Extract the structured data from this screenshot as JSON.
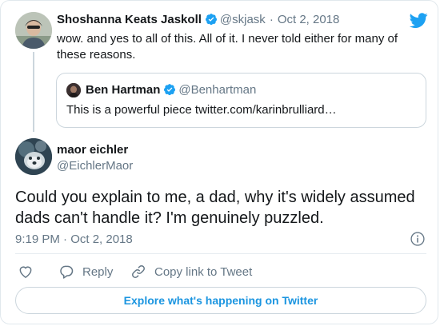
{
  "parent_tweet": {
    "author_name": "Shoshanna Keats Jaskoll",
    "author_handle": "@skjask",
    "separator": "·",
    "date": "Oct 2, 2018",
    "text": "wow. and yes to all of this. All of it. I never told either for many of these reasons."
  },
  "quoted_tweet": {
    "author_name": "Ben Hartman",
    "author_handle": "@Benhartman",
    "text": "This is a powerful piece twitter.com/karinbrulliard…"
  },
  "main_tweet": {
    "author_name": "maor eichler",
    "author_handle": "@EichlerMaor",
    "text": "Could you explain to me, a dad, why it's widely assumed dads can't handle it? I'm genuinely puzzled.",
    "timestamp": "9:19 PM · Oct 2, 2018"
  },
  "actions": {
    "reply_label": "Reply",
    "copy_link_label": "Copy link to Tweet"
  },
  "explore_label": "Explore what's happening on Twitter",
  "colors": {
    "twitter_blue": "#1da1f2",
    "link_blue": "#1b95e0",
    "muted": "#657786",
    "border": "#ccd6dd"
  },
  "icons": [
    "twitter-bird-icon",
    "verified-badge-icon",
    "info-icon",
    "heart-icon",
    "reply-icon",
    "link-icon"
  ]
}
